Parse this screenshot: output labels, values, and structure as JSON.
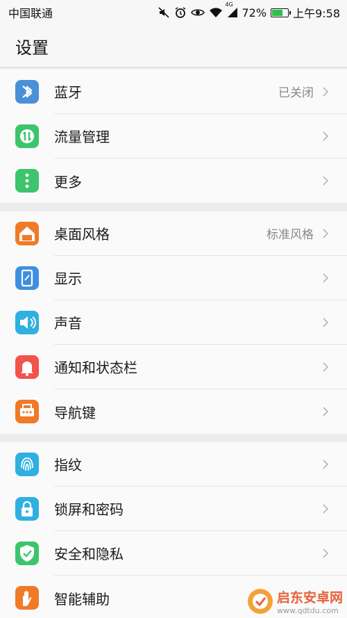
{
  "status_bar": {
    "carrier": "中国联通",
    "network": "4G",
    "battery": "72%",
    "battery_level": 0.72,
    "time": "上午9:58"
  },
  "header": {
    "title": "设置"
  },
  "groups": [
    {
      "items": [
        {
          "label": "蓝牙",
          "value": "已关闭",
          "icon": "bluetooth-icon",
          "color": "#4a90d9"
        },
        {
          "label": "流量管理",
          "value": "",
          "icon": "data-usage-icon",
          "color": "#3dc46d"
        },
        {
          "label": "更多",
          "value": "",
          "icon": "more-icon",
          "color": "#3dc46d"
        }
      ]
    },
    {
      "items": [
        {
          "label": "桌面风格",
          "value": "标准风格",
          "icon": "home-icon",
          "color": "#f07a28"
        },
        {
          "label": "显示",
          "value": "",
          "icon": "display-icon",
          "color": "#3f8fe0"
        },
        {
          "label": "声音",
          "value": "",
          "icon": "sound-icon",
          "color": "#2fb0e0"
        },
        {
          "label": "通知和状态栏",
          "value": "",
          "icon": "bell-icon",
          "color": "#f2534a"
        },
        {
          "label": "导航键",
          "value": "",
          "icon": "navigation-key-icon",
          "color": "#f07a28"
        }
      ]
    },
    {
      "items": [
        {
          "label": "指纹",
          "value": "",
          "icon": "fingerprint-icon",
          "color": "#2fb0e0"
        },
        {
          "label": "锁屏和密码",
          "value": "",
          "icon": "lock-icon",
          "color": "#2fb0e0"
        },
        {
          "label": "安全和隐私",
          "value": "",
          "icon": "shield-icon",
          "color": "#3dc46d"
        },
        {
          "label": "智能辅助",
          "value": "",
          "icon": "hand-icon",
          "color": "#f07a28"
        }
      ]
    }
  ],
  "watermark": {
    "text": "启东安卓网",
    "url": "www.qdtdu.com"
  }
}
